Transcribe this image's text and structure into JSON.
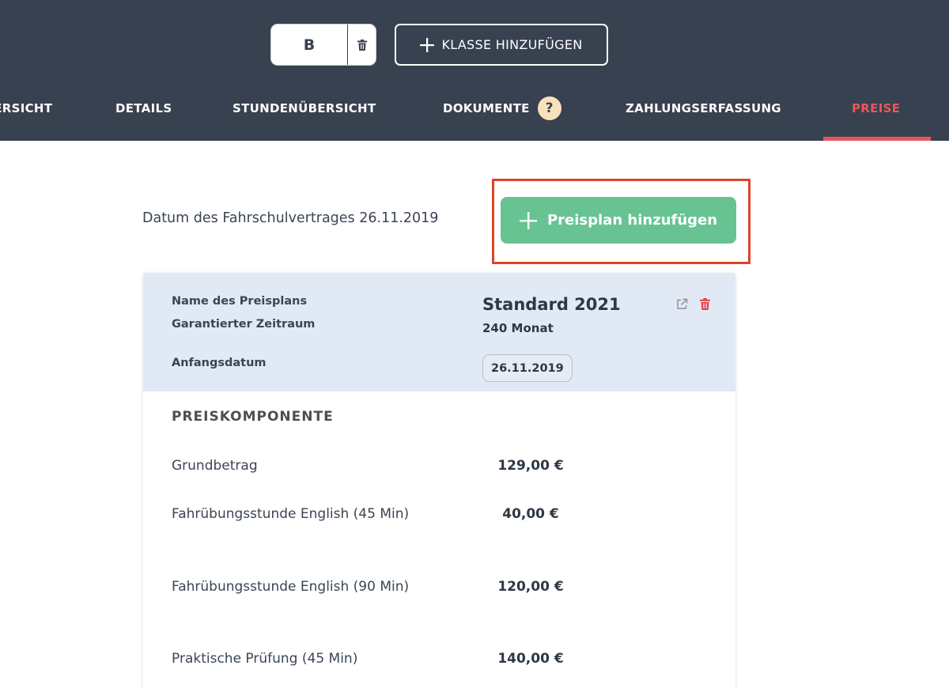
{
  "header": {
    "class_letter": "B",
    "add_class_label": "KLASSE HINZUFÜGEN",
    "tabs": [
      {
        "label": "ÜBERSICHT"
      },
      {
        "label": "DETAILS"
      },
      {
        "label": "STUNDENÜBERSICHT"
      },
      {
        "label": "DOKUMENTE"
      },
      {
        "label": "ZAHLUNGSERFASSUNG"
      },
      {
        "label": "PREISE",
        "active": true
      }
    ],
    "help_badge": "?"
  },
  "main": {
    "contract_date_text": "Datum des Fahrschulvertrages 26.11.2019",
    "add_plan_label": "Preisplan hinzufügen",
    "plan": {
      "name_label": "Name des Preisplans",
      "period_label": "Garantierter Zeitraum",
      "start_label": "Anfangsdatum",
      "name": "Standard 2021",
      "period": "240 Monat",
      "start_date": "26.11.2019"
    },
    "components_title": "PREISKOMPONENTE",
    "components": [
      {
        "name": "Grundbetrag",
        "price": "129,00 €"
      },
      {
        "name": "Fahrübungsstunde English  (45 Min)",
        "price": "40,00 €"
      },
      {
        "name": "Fahrübungsstunde English  (90 Min)",
        "price": "120,00 €"
      },
      {
        "name": "Praktische Prüfung  (45 Min)",
        "price": "140,00 €"
      }
    ]
  },
  "colors": {
    "header_bg": "#384150",
    "accent_red": "#e8565b",
    "primary_green": "#68c393",
    "card_header_bg": "#e1e9f5",
    "highlight_border": "#e0422a"
  },
  "icons": [
    "trash-icon",
    "plus-icon",
    "question-icon",
    "external-link-icon"
  ]
}
